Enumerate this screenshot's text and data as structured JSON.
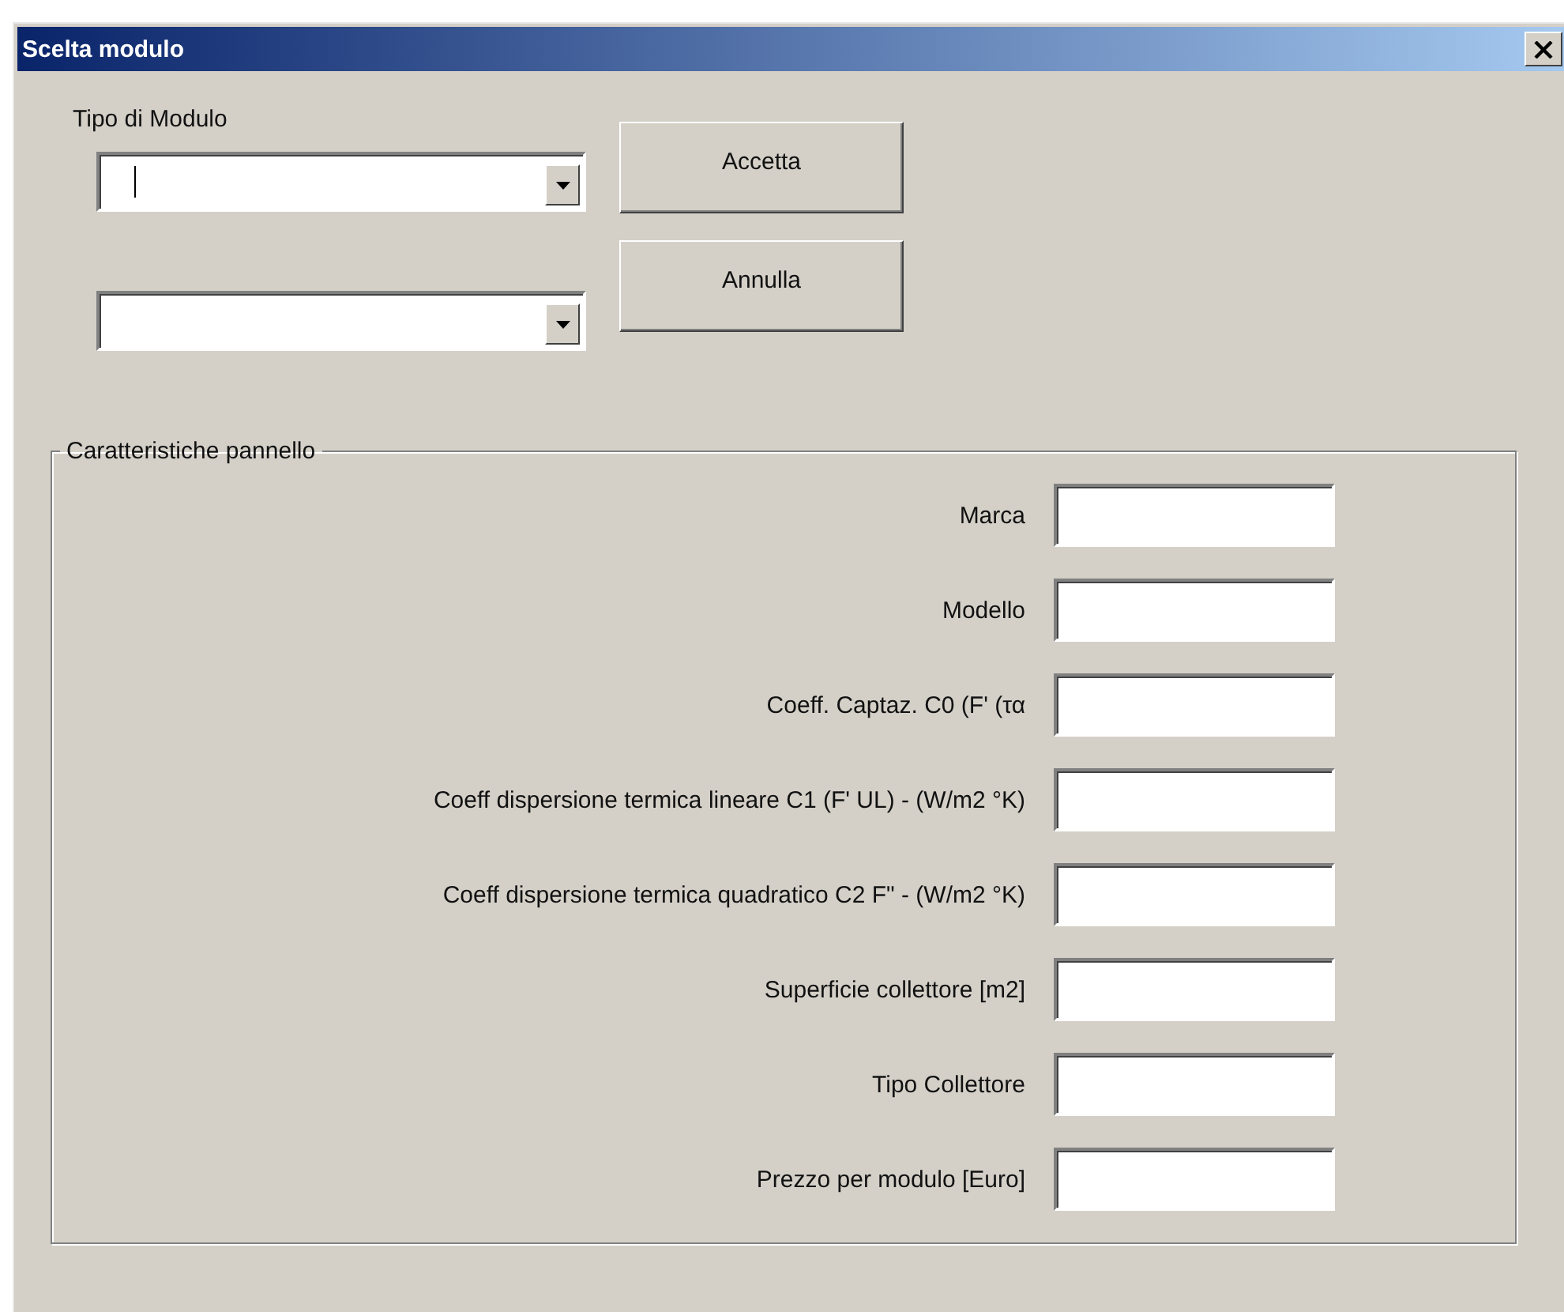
{
  "window": {
    "title": "Scelta modulo"
  },
  "module_type": {
    "label": "Tipo di Modulo",
    "combos": [
      {
        "focused": true
      },
      {
        "focused": false
      }
    ]
  },
  "buttons": [
    "Accetta",
    "Annulla"
  ],
  "panel": {
    "title": "Caratteristiche pannello",
    "fields": [
      {
        "label": "Marca"
      },
      {
        "label": "Modello"
      },
      {
        "label": "Coeff. Captaz. C0 (F' (τα"
      },
      {
        "label": "Coeff dispersione termica lineare C1  (F' UL) - (W/m2 °K)"
      },
      {
        "label": "Coeff dispersione termica quadratico C2 F\" - (W/m2 °K)"
      },
      {
        "label": "Superficie collettore [m2]"
      },
      {
        "label": "Tipo Collettore"
      },
      {
        "label": "Prezzo per modulo [Euro]"
      }
    ]
  }
}
